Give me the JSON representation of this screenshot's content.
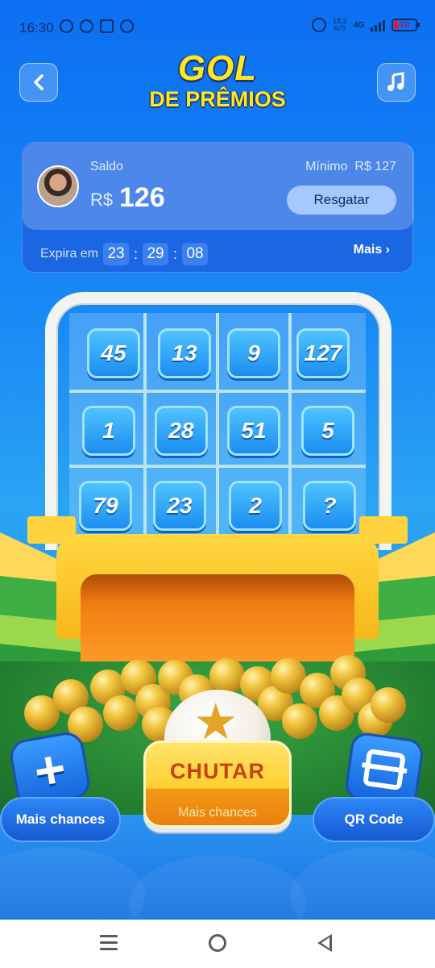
{
  "status_bar": {
    "time": "16:30",
    "speed_value": "18,2",
    "speed_unit": "K/S",
    "network": "4G",
    "battery": "19"
  },
  "header": {
    "logo_line1": "GOL",
    "logo_line2": "DE PRÊMIOS",
    "back_icon": "chevron-left-icon",
    "music_icon": "music-note-icon"
  },
  "balance": {
    "label": "Saldo",
    "currency": "R$",
    "amount": "126",
    "minimum_label": "Mínimo",
    "minimum_value": "R$ 127",
    "redeem_button": "Resgatar",
    "expires_label": "Expira em",
    "timer": {
      "hours": "23",
      "minutes": "29",
      "seconds": "08"
    },
    "more_link": "Mais ›"
  },
  "grid": {
    "cells": [
      "45",
      "13",
      "9",
      "127",
      "1",
      "28",
      "51",
      "5",
      "79",
      "23",
      "2",
      "?"
    ]
  },
  "controls": {
    "more_chances_left": "Mais chances",
    "kick_button": "CHUTAR",
    "kick_subtitle": "Mais chances",
    "qr_code": "QR Code",
    "plus_icon": "plus-icon",
    "qr_icon": "qr-scan-icon"
  },
  "colors": {
    "background_top": "#0b6ff2",
    "logo_yellow": "#ffe81f",
    "kick_text": "#c4430a"
  }
}
